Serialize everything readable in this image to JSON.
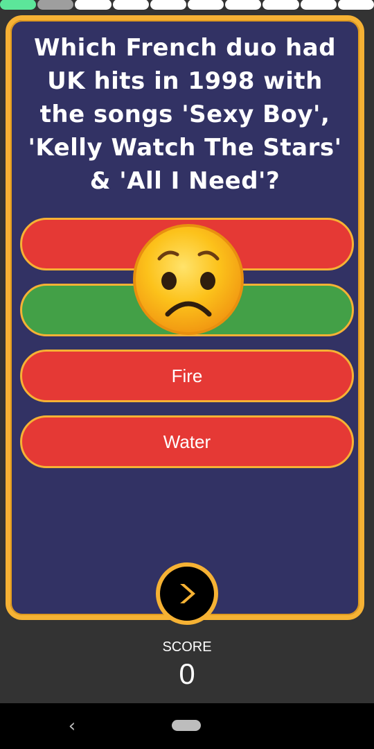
{
  "progress": {
    "total": 10,
    "done": 1,
    "current": 2,
    "colors": {
      "done": "#5ce69a",
      "current": "#9e9e9e",
      "pending": "#ffffff"
    }
  },
  "quiz": {
    "question": "Which French duo had UK hits in 1998 with the songs 'Sexy Boy', 'Kelly Watch The Stars' & 'All I Need'?",
    "answers": [
      {
        "label": "",
        "state": "wrong"
      },
      {
        "label": "",
        "state": "correct"
      },
      {
        "label": "Fire",
        "state": "wrong"
      },
      {
        "label": "Water",
        "state": "wrong"
      }
    ],
    "feedback_icon": "worried-face-emoji",
    "next_icon": "chevron-right-icon"
  },
  "score": {
    "label": "SCORE",
    "value": "0"
  },
  "navbar": {
    "back_icon": "back-chevron-icon",
    "home_icon": "home-pill-icon",
    "back_glyph": "‹"
  },
  "colors": {
    "card_bg": "#323264",
    "card_border": "#f6b234",
    "wrong": "#e53935",
    "correct": "#43a047",
    "page_bg": "#333333"
  }
}
